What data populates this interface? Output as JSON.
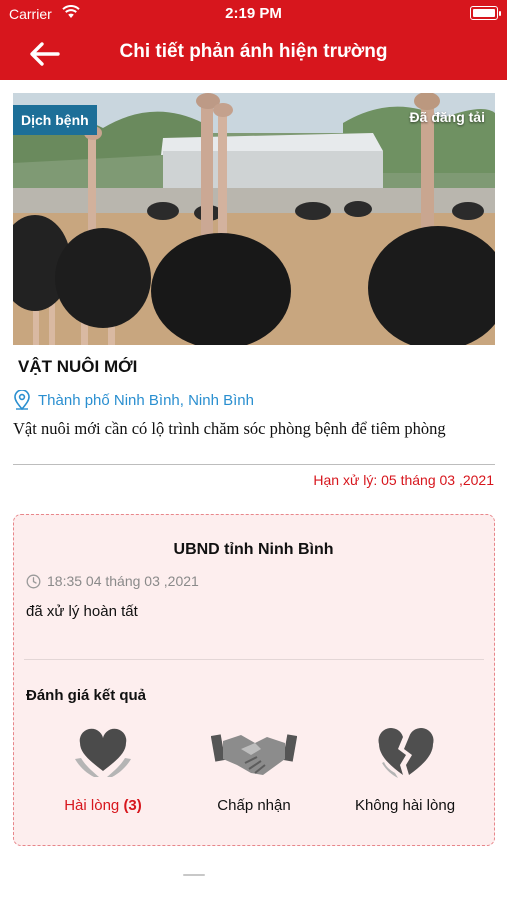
{
  "status_bar": {
    "carrier": "Carrier",
    "time": "2:19 PM"
  },
  "header": {
    "title": "Chi tiết phản ánh hiện trường"
  },
  "report": {
    "category": "Dịch bệnh",
    "status": "Đã đăng tải",
    "title": "VẬT NUÔI MỚI",
    "location": "Thành phố Ninh Bình, Ninh Bình",
    "description": "Vật nuôi mới cần có lộ trình chăm sóc phòng bệnh để tiêm phòng",
    "deadline": "Hạn xử lý: 05 tháng 03 ,2021"
  },
  "response": {
    "agency": "UBND tỉnh Ninh Bình",
    "time": "18:35 04 tháng 03 ,2021",
    "result": "đã xử lý hoàn tất",
    "rating_heading": "Đánh giá kết quả",
    "options": [
      {
        "label": "Hài lòng",
        "count": "(3)"
      },
      {
        "label": "Chấp nhận"
      },
      {
        "label": "Không hài lòng"
      }
    ]
  },
  "colors": {
    "brand": "#d7161d",
    "category_badge": "#1d6f98",
    "location": "#2a8fd0"
  },
  "icons": {
    "back": "arrow-left-icon",
    "wifi": "wifi-icon",
    "battery": "battery-icon",
    "location": "location-pin-icon",
    "clock": "clock-icon",
    "satisfied": "heart-hands-icon",
    "accept": "handshake-icon",
    "dissatisfied": "broken-heart-icon"
  }
}
